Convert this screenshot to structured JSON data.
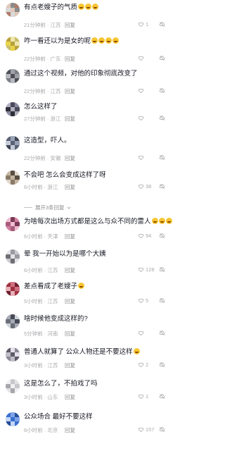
{
  "comments": [
    {
      "text": "有点老嫂子的气质",
      "emojis": 3,
      "time": "21分钟前 · 江苏",
      "reply": "回复",
      "likes": "1"
    },
    {
      "text": "咋一看还以为是女的呢",
      "emojis": 4,
      "time": "22分钟前 · 广东",
      "reply": "回复",
      "likes": ""
    },
    {
      "text": "通过这个视频，对他的印象彻底改变了",
      "emojis": 0,
      "time": "22分钟前 · 江苏",
      "reply": "回复",
      "likes": ""
    },
    {
      "text": "怎么这样了",
      "emojis": 0,
      "time": "27分钟前 · 浙江",
      "reply": "回复",
      "likes": ""
    },
    {
      "text": "这造型，吓人。",
      "emojis": 0,
      "time": "22分钟前 · 安徽",
      "reply": "回复",
      "likes": ""
    },
    {
      "text": "不会吧 怎么会变成这样了呀",
      "emojis": 0,
      "time": "6小时前 · 浙江",
      "reply": "回复",
      "likes": "38"
    },
    {
      "text": "为啥每次出场方式都是这么与众不同的雷人",
      "emojis": 3,
      "time": "6小时前 · 天津",
      "reply": "回复",
      "likes": "94"
    },
    {
      "text": "晕 我一开始以为是哪个大姨",
      "emojis": 0,
      "time": "6小时前 · 江苏",
      "reply": "回复",
      "likes": "128"
    },
    {
      "text": "差点看成了老嫂子",
      "emojis": 1,
      "time": "5小时前 · 江苏",
      "reply": "回复",
      "likes": "5"
    },
    {
      "text": "啥时候他变成这样的?",
      "emojis": 0,
      "time": "5分钟前 · 河南",
      "reply": "回复",
      "likes": ""
    },
    {
      "text": "普通人就算了 公众人物还是不要这样",
      "emojis": 1,
      "time": "3小时前 · 江苏",
      "reply": "回复",
      "likes": "2"
    },
    {
      "text": "这是怎么了，不拍戏了吗",
      "emojis": 0,
      "time": "3小时前 · 山东",
      "reply": "回复",
      "likes": "1"
    },
    {
      "text": "公众场合 最好不要这样",
      "emojis": 0,
      "time": "6小时前 · 北京",
      "reply": "回复",
      "likes": "157"
    }
  ],
  "expand_label": "展开3条回复",
  "colors": {
    "text": "#161823",
    "meta": "#a8a9ad",
    "emoji": "#f7c531"
  },
  "icons": {
    "like": "heart-outline-icon",
    "dislike": "dislike-icon",
    "expand": "chevron-down-icon"
  }
}
